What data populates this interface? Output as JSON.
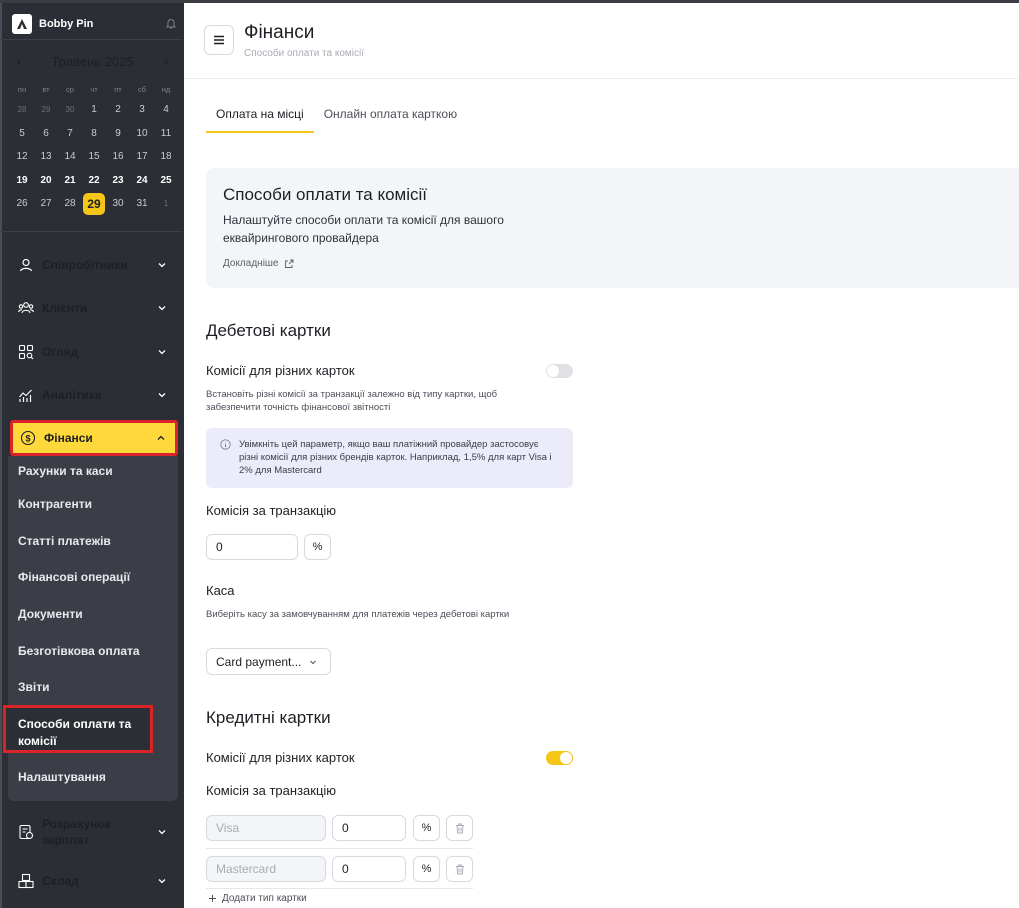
{
  "sidebar": {
    "brand": "Bobby Pin",
    "calendar": {
      "month_label": "Травень 2025",
      "weekdays": [
        "пн",
        "вт",
        "ср",
        "чт",
        "пт",
        "сб",
        "нд"
      ],
      "weeks": [
        [
          {
            "d": "28",
            "t": "dim"
          },
          {
            "d": "29",
            "t": "dim"
          },
          {
            "d": "30",
            "t": "dim"
          },
          {
            "d": "1",
            "t": "n"
          },
          {
            "d": "2",
            "t": "n"
          },
          {
            "d": "3",
            "t": "n"
          },
          {
            "d": "4",
            "t": "n"
          }
        ],
        [
          {
            "d": "5",
            "t": "n"
          },
          {
            "d": "6",
            "t": "n"
          },
          {
            "d": "7",
            "t": "n"
          },
          {
            "d": "8",
            "t": "n"
          },
          {
            "d": "9",
            "t": "n"
          },
          {
            "d": "10",
            "t": "n"
          },
          {
            "d": "11",
            "t": "n"
          }
        ],
        [
          {
            "d": "12",
            "t": "n"
          },
          {
            "d": "13",
            "t": "n"
          },
          {
            "d": "14",
            "t": "n"
          },
          {
            "d": "15",
            "t": "n"
          },
          {
            "d": "16",
            "t": "n"
          },
          {
            "d": "17",
            "t": "n"
          },
          {
            "d": "18",
            "t": "n"
          }
        ],
        [
          {
            "d": "19",
            "t": "bold"
          },
          {
            "d": "20",
            "t": "bold"
          },
          {
            "d": "21",
            "t": "bold"
          },
          {
            "d": "22",
            "t": "bold"
          },
          {
            "d": "23",
            "t": "bold"
          },
          {
            "d": "24",
            "t": "bold"
          },
          {
            "d": "25",
            "t": "bold"
          }
        ],
        [
          {
            "d": "26",
            "t": "n"
          },
          {
            "d": "27",
            "t": "n"
          },
          {
            "d": "28",
            "t": "n"
          },
          {
            "d": "29",
            "t": "today"
          },
          {
            "d": "30",
            "t": "n"
          },
          {
            "d": "31",
            "t": "n"
          },
          {
            "d": "1",
            "t": "dim"
          }
        ]
      ]
    },
    "nav": {
      "employees": "Співробітники",
      "clients": "Клієнти",
      "overview": "Огляд",
      "analytics": "Аналітика",
      "finance": "Фінанси",
      "payroll": "Розрахунок зарплат",
      "warehouse": "Склад"
    },
    "finance_sub": {
      "accounts": "Рахунки та каси",
      "counterparties": "Контрагенти",
      "payment_items": "Статті платежів",
      "operations": "Фінансові операції",
      "documents": "Документи",
      "cashless": "Безготівкова оплата",
      "reports": "Звіти",
      "payment_methods": "Способи оплати та комісії",
      "settings": "Налаштування"
    }
  },
  "header": {
    "title": "Фінанси",
    "subtitle": "Способи оплати та комісії"
  },
  "tabs": {
    "onsite": "Оплата на місці",
    "online": "Онлайн оплата карткою"
  },
  "info_card": {
    "title": "Способи оплати та комісії",
    "description": "Налаштуйте способи оплати та комісії для вашого еквайрингового провайдера",
    "link": "Докладніше"
  },
  "debit": {
    "heading": "Дебетові картки",
    "diff_fees_label": "Комісії для різних карток",
    "diff_fees_enabled": false,
    "diff_fees_desc": "Встановіть різні комісії за транзакції залежно від типу картки, щоб забезпечити точність фінансової звітності",
    "note": "Увімкніть цей параметр, якщо ваш платіжний провайдер застосовує різні комісії для різних брендів карток. Наприклад, 1,5% для карт Visa і 2% для Mastercard",
    "fee_label": "Комісія за транзакцію",
    "fee_value": "0",
    "fee_unit": "%",
    "cashbox_label": "Каса",
    "cashbox_desc": "Виберіть касу за замовчуванням для платежів через дебетові картки",
    "cashbox_value": "Card payment..."
  },
  "credit": {
    "heading": "Кредитні картки",
    "diff_fees_label": "Комісії для різних карток",
    "diff_fees_enabled": true,
    "fee_label": "Комісія за транзакцію",
    "rows": [
      {
        "card_placeholder": "Visa",
        "fee": "0",
        "unit": "%"
      },
      {
        "card_placeholder": "Mastercard",
        "fee": "0",
        "unit": "%"
      }
    ],
    "add_label": "Додати тип картки"
  },
  "colors": {
    "accent": "#f5c518",
    "sidebar_bg": "#2b2e35",
    "highlight_red": "#d9242a"
  }
}
